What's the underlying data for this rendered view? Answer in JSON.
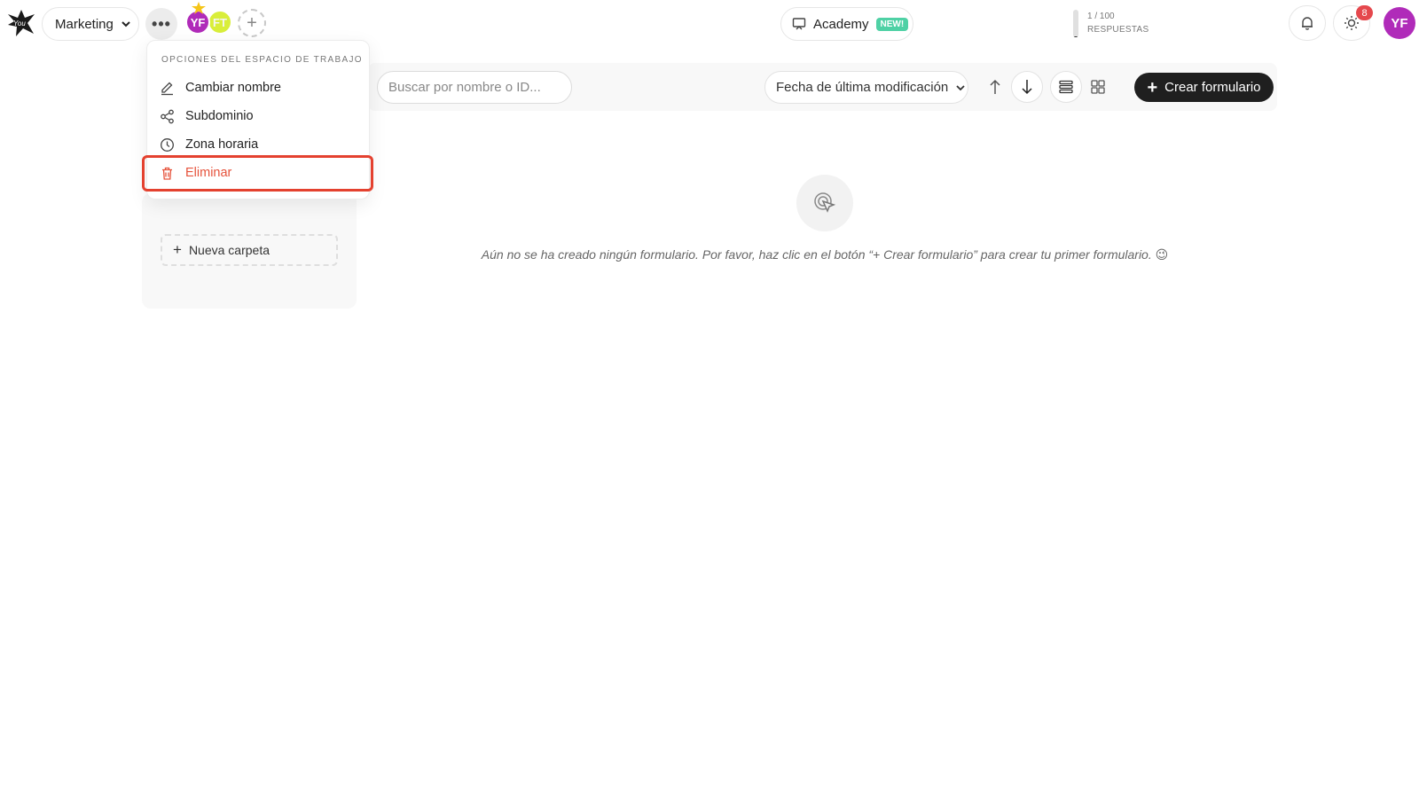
{
  "header": {
    "workspace_name": "Marketing",
    "members": [
      {
        "initials": "YF",
        "color": "#b02bb9"
      },
      {
        "initials": "FT",
        "color": "#d9ee3a"
      }
    ],
    "academy_label": "Academy",
    "academy_badge": "NEW!",
    "responses_count": "1 / 100",
    "responses_label": "RESPUESTAS",
    "responses_fraction": 0.01,
    "notification_count": "8",
    "user_initials": "YF"
  },
  "toolbar": {
    "search_placeholder": "Buscar por nombre o ID...",
    "sort_selected": "Fecha de última modificación",
    "create_label": "Crear formulario"
  },
  "sidebar": {
    "new_folder_label": "Nueva carpeta"
  },
  "empty_state": {
    "message": "Aún no se ha creado ningún formulario. Por favor, haz clic en el botón “+ Crear formulario” para crear tu primer formulario. 😉"
  },
  "workspace_menu": {
    "header": "OPCIONES DEL ESPACIO DE TRABAJO",
    "items": [
      {
        "label": "Cambiar nombre",
        "icon": "pencil-icon"
      },
      {
        "label": "Subdominio",
        "icon": "share-nodes-icon"
      },
      {
        "label": "Zona horaria",
        "icon": "clock-icon"
      },
      {
        "label": "Eliminar",
        "icon": "trash-icon"
      }
    ]
  },
  "colors": {
    "accent_dark": "#1f1f1f",
    "danger": "#e6533c",
    "highlight": "#e4412f",
    "avatar_purple": "#b02bb9",
    "new_badge": "#4fd1a5"
  }
}
